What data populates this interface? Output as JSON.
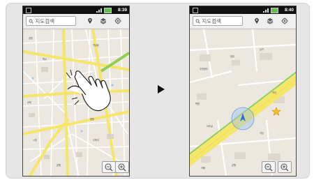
{
  "left_screen": {
    "status_time": "8:39",
    "search_placeholder": "지도검색"
  },
  "right_screen": {
    "status_time": "8:40",
    "search_placeholder": "지도검색"
  },
  "icons": {
    "search": "search-icon",
    "place": "place-pin-icon",
    "layers": "layers-icon",
    "location": "my-location-icon",
    "zoom_out": "zoom-out-icon",
    "zoom_in": "zoom-in-icon",
    "transition": "play-arrow-icon"
  },
  "colors": {
    "major_road": "#f5e66a",
    "highway": "#8fce4f",
    "map_background": "#ece7df",
    "location_accuracy": "#9ec3ee"
  }
}
